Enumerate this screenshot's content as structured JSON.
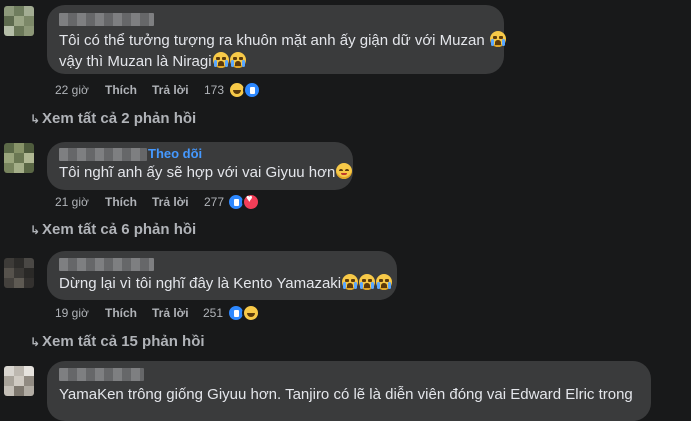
{
  "colors": {
    "background": "#18191a",
    "bubble": "#3a3b3c",
    "text": "#e4e6eb",
    "meta": "#b0b3b8",
    "follow": "#4599ff"
  },
  "comments": [
    {
      "lines": [
        "Tôi có thể tưởng tượng ra khuôn mặt anh ấy giận dữ với Muzan",
        "vậy thì Muzan là Niragi"
      ],
      "line_emojis": [
        [
          "crying-face"
        ],
        [
          "crying-face",
          "crying-face"
        ]
      ],
      "time": "22 giờ",
      "like": "Thích",
      "reply": "Trả lời",
      "reaction_count": "173",
      "reactions": [
        "haha",
        "like"
      ],
      "view_replies": "Xem tất cả 2 phản hồi"
    },
    {
      "follow": "Theo dõi",
      "lines": [
        "Tôi nghĩ anh ấy sẽ hợp với vai Giyuu hơn"
      ],
      "line_emojis": [
        [
          "smiling-face"
        ]
      ],
      "time": "21 giờ",
      "like": "Thích",
      "reply": "Trả lời",
      "reaction_count": "277",
      "reactions": [
        "like",
        "love"
      ],
      "view_replies": "Xem tất cả 6 phản hồi"
    },
    {
      "lines": [
        "Dừng lại vì tôi nghĩ đây là Kento Yamazaki"
      ],
      "line_emojis": [
        [
          "crying-face",
          "crying-face",
          "crying-face"
        ]
      ],
      "time": "19 giờ",
      "like": "Thích",
      "reply": "Trả lời",
      "reaction_count": "251",
      "reactions": [
        "like",
        "haha"
      ],
      "view_replies": "Xem tất cả 15 phản hồi"
    },
    {
      "lines": [
        "YamaKen trông giống Giyuu hơn. Tanjiro có lẽ là diễn viên đóng vai Edward Elric trong"
      ]
    }
  ]
}
